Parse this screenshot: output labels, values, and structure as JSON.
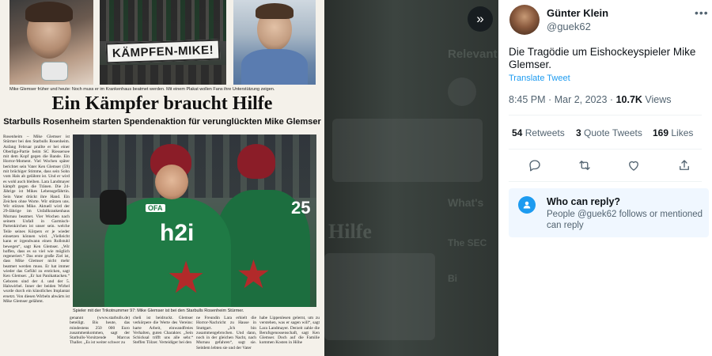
{
  "viewer": {
    "collapse_icon": "double-chevron-right-icon",
    "collapse_glyph": "»",
    "ghost_text": [
      "Relevant",
      "What's",
      "Hilfe",
      "The SEC",
      "Bi"
    ]
  },
  "newspaper": {
    "photo_caption": "Mike Glemser früher und heute: Noch muss er im Krankenhaus beatmet werden. Mit einem Plakat wollen Fans ihre Unterstützung zeigen.",
    "banner_text": "KÄMPFEN-MIKE!",
    "headline": "Ein Kämpfer braucht Hilfe",
    "subline": "Starbulls Rosenheim starten Spendenaktion für verunglückten Mike Glemser",
    "photo_caption_2": "Spieler mit der Trikotnummer 97: Mike Glemser ist bei den Starbulls Rosenheim Stürmer.",
    "jersey_logo": "h2i",
    "jersey_sponsor": "OFA",
    "jersey_number": "25",
    "article_left": "Rosenheim – Mike Glemser ist Stürmer bei den Starbulls Rosenheim. Anfang Februar prallte er bei einer Oberliga-Partie beim SC Riessersee mit dem Kopf gegen die Bande. Ein Horror-Moment. Viel Wochen später berichtet sein Vater Ken Glemser (59) mit brüchiger Stimme, dass sein Sohn vom Hals ab gelähmt ist. Und er wird es wohl auch bleiben. Lara Landmayer kämpft gegen die Tränen. Die 24-Jährige ist Mikes Lebensgefährtin. Sein Vater drückt ihre Hand. Ein Zeichen ohne Worte. Wir stützen uns. Wir stützen Mike. Aktuell wird der 29-Jährige im Unfallkrankenhaus Murnau beatmet. Vier Wochen nach seinem Unfall in Garmisch-Partenkirchen ist unser sein. welche Teile seines Körpers er je wieder einsetzen können wird. „Vielleicht kann er irgendwann einen Rollstuhl bewegen“, sagt Ken Glemser. „Wir hoffen, dass es so viel wie möglich regeneriert.“ Das erste große Ziel ist, dass Mike Glemser nicht mehr beatmet werden muss. Er hat immer wieder das Gefühl zu ersticken, sagt Ken Glemser. „Er hat Panikattacken.“ Geboren sind der 4. und der 5. Halswirbel. Inner der beiden Wirbel wurde durch ein künstliches Implantat ersetzt. Von diesen Wirbeln abwärts ist Mike Glemser gelähmt.",
    "article_b1": "genannt (www.starbulls.de) beteiligt. Bis heute, das mindestens 250 000 Euro zusammenkommen, sagt der Starbulls-Vorsitzende Marcus Thaller. „Es ist weiter schwer zu",
    "article_b2": "cheli ist beidruckt. Glemser verkörpere die Werte des Vereins: harte Arbeit, einwandfreies Verhalten, guten Charakter. „Sein Schicksal trifft uns alle sehr.“ Steffen Tölzer. Verteidiger bei den",
    "article_b3": "ne Freundin Lara erhielt die Horror-Nachricht zu Hause in Stuttgart. „Ich bin zusammengebrochen. Und dann, noch in der gleichen Nacht, nach Murnau gefahren“, sagt sie. Seitdem lebten sie und der Vater",
    "article_b4": "habe Lippenlesen gelernt, um zu verstehen, was er sagen will“, sagt Lara Landmayer. Derzeit zahle die Berufsgenossenschaft, sagt Ken Glemser. Doch auf die Familie kommen Kosten in Höhe"
  },
  "tweet": {
    "display_name": "Günter Klein",
    "handle": "@guek62",
    "more_icon": "more-dots-icon",
    "text": "Die Tragödie um Eishockeyspieler Mike Glemser.",
    "translate_label": "Translate Tweet",
    "time": "8:45 PM",
    "separator": "·",
    "date": "Mar 2, 2023",
    "views_count": "10.7K",
    "views_label": "Views",
    "retweets_count": "54",
    "retweets_label": "Retweets",
    "quotes_count": "3",
    "quotes_label": "Quote Tweets",
    "likes_count": "169",
    "likes_label": "Likes",
    "actions": [
      "reply-icon",
      "retweet-icon",
      "like-icon",
      "share-icon"
    ]
  },
  "reply_restriction": {
    "title": "Who can reply?",
    "description": "People @guek62 follows or mentioned can reply",
    "icon": "person-icon"
  },
  "colors": {
    "link_blue": "#1d9bf0",
    "text_primary": "#0f1419",
    "text_secondary": "#536471",
    "jersey_green": "#1f7a45",
    "helmet_red": "#8b1d28"
  }
}
